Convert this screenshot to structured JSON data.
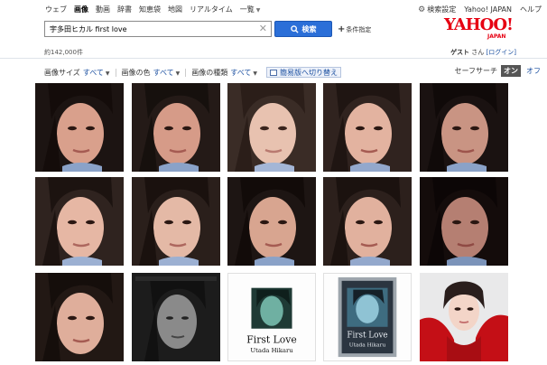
{
  "nav": {
    "tabs": [
      {
        "label": "ウェブ",
        "active": false
      },
      {
        "label": "画像",
        "active": true
      },
      {
        "label": "動画",
        "active": false
      },
      {
        "label": "辞書",
        "active": false
      },
      {
        "label": "知恵袋",
        "active": false
      },
      {
        "label": "地図",
        "active": false
      },
      {
        "label": "リアルタイム",
        "active": false
      },
      {
        "label": "一覧",
        "active": false
      }
    ],
    "settings_label": "検索設定",
    "home_label": "Yahoo! JAPAN",
    "help_label": "ヘルプ"
  },
  "search": {
    "query": "宇多田ヒカル first love",
    "button_label": "検索",
    "advanced_label": "条件指定"
  },
  "logo": {
    "word": "YAHOO!",
    "sub": "JAPAN"
  },
  "user": {
    "name": "ゲスト",
    "suffix": "さん",
    "login_label": "[ログイン]"
  },
  "results_count": "約142,000件",
  "filters": [
    {
      "label": "画像サイズ",
      "value": "すべて"
    },
    {
      "label": "画像の色",
      "value": "すべて"
    },
    {
      "label": "画像の種類",
      "value": "すべて"
    }
  ],
  "simple_view_label": "簡易版へ切り替え",
  "safesearch": {
    "label": "セーフサーチ",
    "on_label": "オン",
    "off_label": "オフ"
  },
  "cover_texts": {
    "title_1": "First Love",
    "artist_1": "Utada Hikaru",
    "title_2": "First Love",
    "artist_2": "Utada Hikaru"
  },
  "colors": {
    "accent": "#2b6fd8",
    "brand": "#e60012",
    "link": "#1a4fa0"
  }
}
